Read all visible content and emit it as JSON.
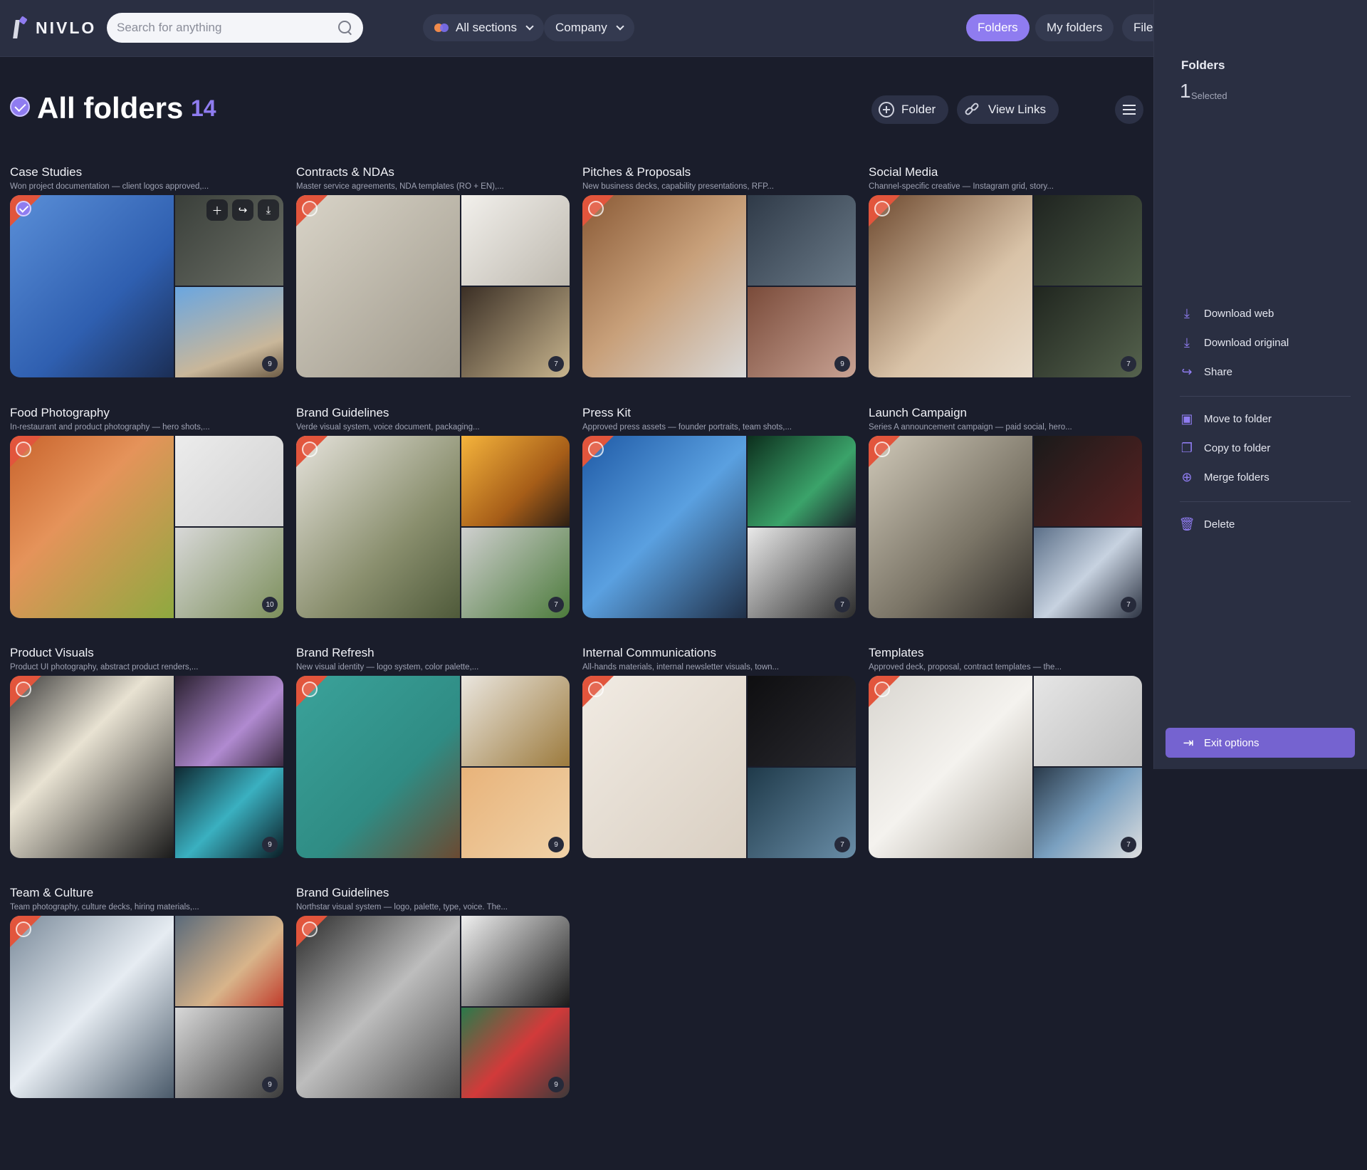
{
  "topbar": {
    "logo_text": "NIVLO",
    "search_placeholder": "Search for anything",
    "sections_label": "All sections",
    "company_label": "Company",
    "tabs": [
      {
        "label": "Folders",
        "active": true
      },
      {
        "label": "My folders",
        "active": false
      },
      {
        "label": "Files",
        "active": false
      }
    ]
  },
  "header": {
    "title": "All folders",
    "count": "14",
    "folder_button": "Folder",
    "view_links_button": "View Links"
  },
  "folders": [
    {
      "title": "Case Studies",
      "desc": "Won project documentation — client logos approved,...",
      "count": "9",
      "selected": true
    },
    {
      "title": "Contracts & NDAs",
      "desc": "Master service agreements, NDA templates (RO + EN),...",
      "count": "7",
      "selected": false
    },
    {
      "title": "Pitches & Proposals",
      "desc": "New business decks, capability presentations, RFP...",
      "count": "9",
      "selected": false
    },
    {
      "title": "Social Media",
      "desc": "Channel-specific creative — Instagram grid, story...",
      "count": "7",
      "selected": false
    },
    {
      "title": "Food Photography",
      "desc": "In-restaurant and product photography — hero shots,...",
      "count": "10",
      "selected": false
    },
    {
      "title": "Brand Guidelines",
      "desc": "Verde visual system, voice document, packaging...",
      "count": "7",
      "selected": false
    },
    {
      "title": "Press Kit",
      "desc": "Approved press assets — founder portraits, team shots,...",
      "count": "7",
      "selected": false
    },
    {
      "title": "Launch Campaign",
      "desc": "Series A announcement campaign — paid social, hero...",
      "count": "7",
      "selected": false
    },
    {
      "title": "Product Visuals",
      "desc": "Product UI photography, abstract product renders,...",
      "count": "9",
      "selected": false
    },
    {
      "title": "Brand Refresh",
      "desc": "New visual identity — logo system, color palette,...",
      "count": "9",
      "selected": false
    },
    {
      "title": "Internal Communications",
      "desc": "All-hands materials, internal newsletter visuals, town...",
      "count": "7",
      "selected": false
    },
    {
      "title": "Templates",
      "desc": "Approved deck, proposal, contract templates — the...",
      "count": "7",
      "selected": false
    },
    {
      "title": "Team & Culture",
      "desc": "Team photography, culture decks, hiring materials,...",
      "count": "9",
      "selected": false
    },
    {
      "title": "Brand Guidelines",
      "desc": "Northstar visual system — logo, palette, type, voice. The...",
      "count": "9",
      "selected": false
    }
  ],
  "panel": {
    "title": "Folders",
    "selected_count": "1",
    "selected_label": "Selected",
    "actions": {
      "download_web": "Download web",
      "download_original": "Download original",
      "share": "Share",
      "move": "Move to folder",
      "copy": "Copy to folder",
      "merge": "Merge folders",
      "delete": "Delete"
    },
    "exit": "Exit options"
  },
  "colors": {
    "accent": "#8f7cf0",
    "background": "#1a1d2b",
    "panel": "#2a2f42",
    "corner_flag": "#e2553c"
  }
}
